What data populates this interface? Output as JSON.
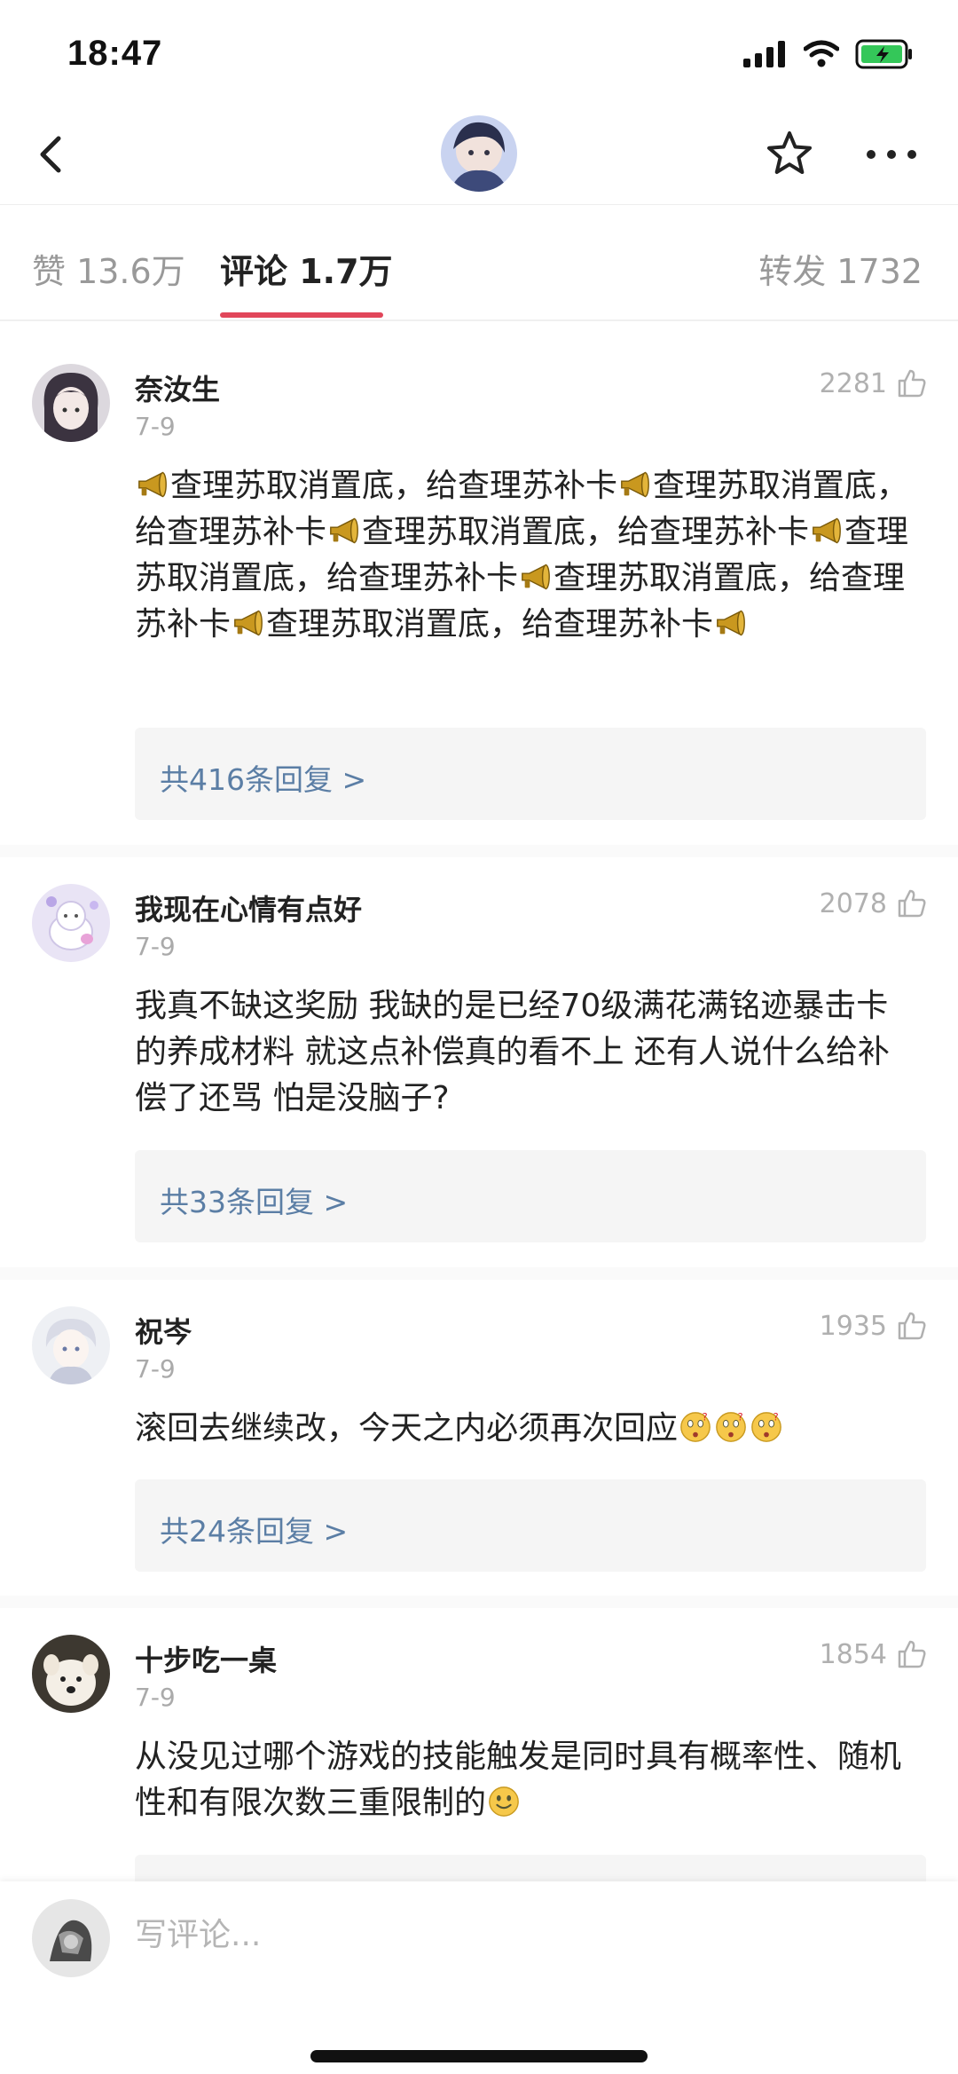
{
  "status_bar": {
    "time": "18:47"
  },
  "tabs": {
    "likes": "赞 13.6万",
    "comments": "评论 1.7万",
    "reposts": "转发 1732"
  },
  "comments": [
    {
      "username": "奈汝生",
      "date": "7-9",
      "likes": "2281",
      "segments": [
        "查理苏取消置底，给查理苏补卡",
        "查理苏取消置底，给查理苏补卡",
        "查理苏取消置底，给查理苏补卡",
        "查理苏取消置底，给查理苏补卡",
        "查理苏取消置底，给查理苏补卡",
        "查理苏取消置底，给查理苏补卡"
      ],
      "emoji": "megaphone",
      "replies": "共416条回复 >"
    },
    {
      "username": "我现在心情有点好",
      "date": "7-9",
      "likes": "2078",
      "text": "我真不缺这奖励 我缺的是已经70级满花满铭迹暴击卡的养成材料 就这点补偿真的看不上 还有人说什么给补偿了还骂 怕是没脑子?",
      "replies": "共33条回复 >"
    },
    {
      "username": "祝岑",
      "date": "7-9",
      "likes": "1935",
      "text": "滚回去继续改，今天之内必须再次回应",
      "emoji": "thinking-face",
      "emoji_count": 3,
      "replies": "共24条回复 >"
    },
    {
      "username": "十步吃一桌",
      "date": "7-9",
      "likes": "1854",
      "text": "从没见过哪个游戏的技能触发是同时具有概率性、随机性和有限次数三重限制的",
      "emoji": "smile-face"
    }
  ],
  "comment_box": {
    "placeholder": "写评论..."
  }
}
